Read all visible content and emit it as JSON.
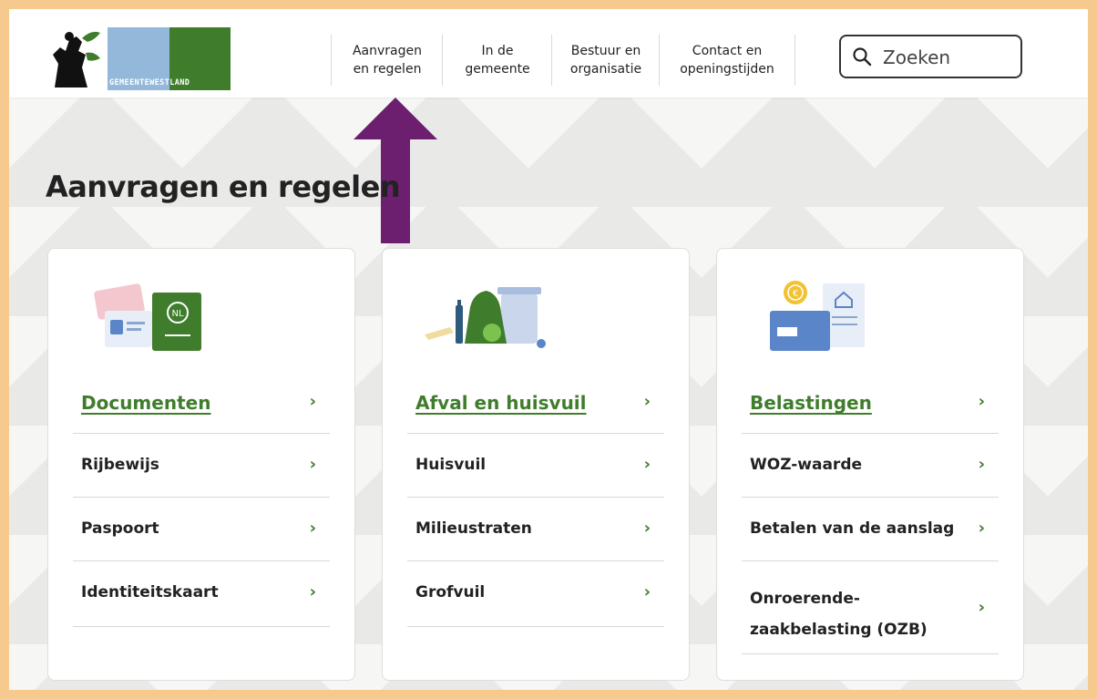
{
  "header": {
    "logo_text_1": "GEMEENTE",
    "logo_text_2": "WESTLAND",
    "nav": [
      {
        "label": "Aanvragen\nen regelen"
      },
      {
        "label": "In de\ngemeente"
      },
      {
        "label": "Bestuur en\norganisatie"
      },
      {
        "label": "Contact en\nopeningstijden"
      }
    ],
    "search": {
      "placeholder": "Zoeken"
    }
  },
  "page": {
    "title": "Aanvragen en regelen"
  },
  "cards": [
    {
      "title": "Documenten",
      "items": [
        "Rijbewijs",
        "Paspoort",
        "Identiteitskaart"
      ]
    },
    {
      "title": "Afval en huisvuil",
      "items": [
        "Huisvuil",
        "Milieustraten",
        "Grofvuil"
      ]
    },
    {
      "title": "Belastingen",
      "items": [
        "WOZ-waarde",
        "Betalen van de aanslag",
        "Onroerende-\nzaakbelasting (OZB)"
      ]
    }
  ],
  "chevron": "›",
  "colors": {
    "accent": "#3f7d2c",
    "arrow": "#6b1f6e",
    "frame": "#f6c98f"
  }
}
